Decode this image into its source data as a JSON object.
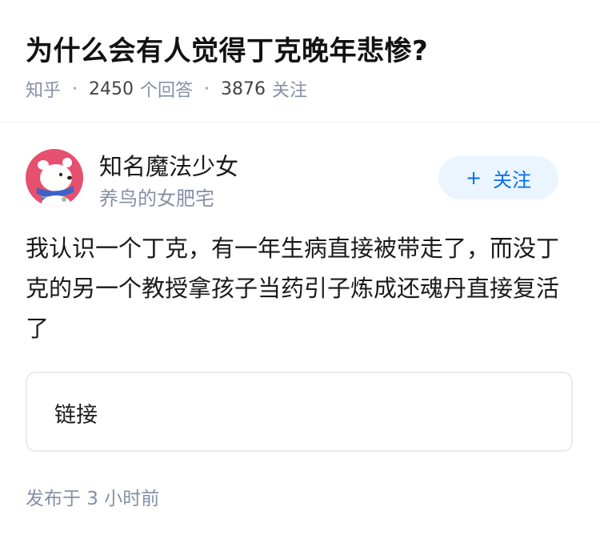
{
  "question": {
    "title": "为什么会有人觉得丁克晚年悲惨?",
    "source": "知乎",
    "answer_count": "2450",
    "answer_label": "个回答",
    "follow_count": "3876",
    "follow_label": "关注"
  },
  "author": {
    "name": "知名魔法少女",
    "bio": "养鸟的女肥宅",
    "follow_plus": "+",
    "follow_button": "关注",
    "avatar_icon": "cartoon-bear-avatar"
  },
  "answer": {
    "text": "我认识一个丁克，有一年生病直接被带走了，而没丁克的另一个教授拿孩子当药引子炼成还魂丹直接复活了",
    "link_label": "链接",
    "published": "发布于 3 小时前"
  },
  "colors": {
    "accent": "#056de8",
    "button_bg": "#ebf5ff",
    "muted": "#8590a6",
    "avatar_bg": "#e6506f"
  }
}
